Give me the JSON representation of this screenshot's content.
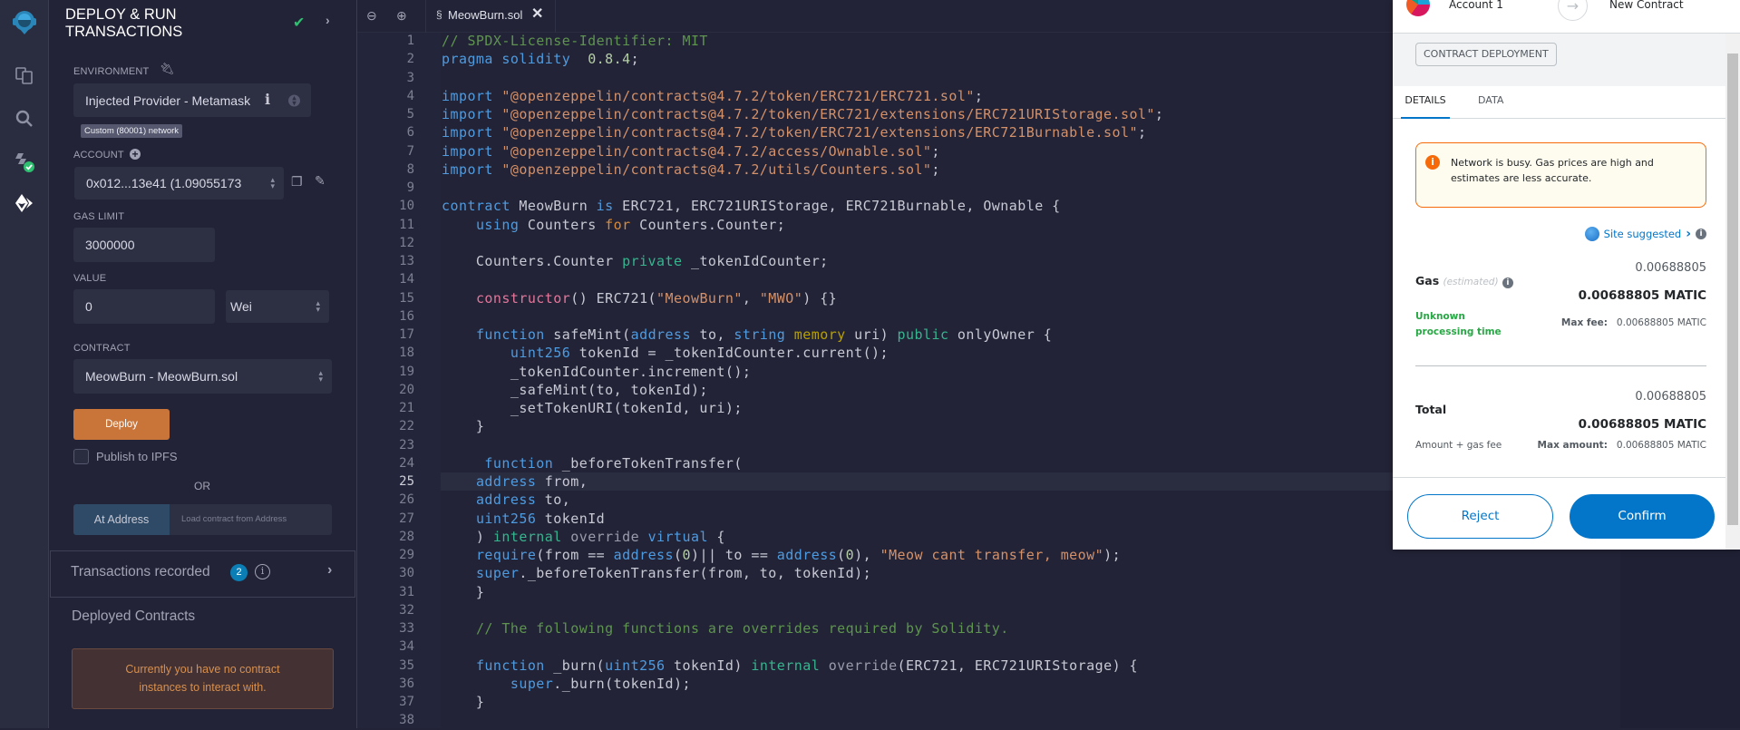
{
  "iconbar": {
    "items": [
      "remix-logo-icon",
      "file-explorer-icon",
      "search-icon",
      "solidity-compiler-icon",
      "deploy-run-icon"
    ]
  },
  "side": {
    "title_line1": "DEPLOY & RUN",
    "title_line2": "TRANSACTIONS",
    "environment_label": "ENVIRONMENT",
    "environment_value": "Injected Provider - Metamask",
    "network_badge": "Custom (80001) network",
    "account_label": "ACCOUNT",
    "account_value": "0x012...13e41 (1.09055173",
    "gas_limit_label": "GAS LIMIT",
    "gas_limit_value": "3000000",
    "value_label": "VALUE",
    "value_value": "0",
    "value_unit": "Wei",
    "contract_label": "CONTRACT",
    "contract_value": "MeowBurn - MeowBurn.sol",
    "deploy_button": "Deploy",
    "publish_ipfs": "Publish to IPFS",
    "publish_ipfs_checked": false,
    "or": "OR",
    "at_address_button": "At Address",
    "at_address_placeholder": "Load contract from Address",
    "transactions_recorded": "Transactions recorded",
    "transactions_count": "2",
    "deployed_contracts": "Deployed Contracts",
    "no_instances": "Currently you have no contract instances to interact with.",
    "colors": {
      "deploy": "#c97539",
      "at_address": "#2e4a66",
      "badge": "#0b7fb5",
      "success": "#2fbf71"
    }
  },
  "editor": {
    "tab_label": "MeowBurn.sol",
    "current_line": 25,
    "lines": [
      [
        [
          "t-c",
          "// SPDX-License-Identifier: MIT"
        ]
      ],
      [
        [
          "t-k",
          "pragma solidity"
        ],
        [
          "",
          "  "
        ],
        [
          "t-n",
          "0.8.4"
        ],
        [
          "",
          ";"
        ]
      ],
      [],
      [
        [
          "t-k",
          "import"
        ],
        [
          "",
          " "
        ],
        [
          "t-s",
          "\"@openzeppelin/contracts@4.7.2/token/ERC721/ERC721.sol\""
        ],
        [
          "",
          ";"
        ]
      ],
      [
        [
          "t-k",
          "import"
        ],
        [
          "",
          " "
        ],
        [
          "t-s",
          "\"@openzeppelin/contracts@4.7.2/token/ERC721/extensions/ERC721URIStorage.sol\""
        ],
        [
          "",
          ";"
        ]
      ],
      [
        [
          "t-k",
          "import"
        ],
        [
          "",
          " "
        ],
        [
          "t-s",
          "\"@openzeppelin/contracts@4.7.2/token/ERC721/extensions/ERC721Burnable.sol\""
        ],
        [
          "",
          ";"
        ]
      ],
      [
        [
          "t-k",
          "import"
        ],
        [
          "",
          " "
        ],
        [
          "t-s",
          "\"@openzeppelin/contracts@4.7.2/access/Ownable.sol\""
        ],
        [
          "",
          ";"
        ]
      ],
      [
        [
          "t-k",
          "import"
        ],
        [
          "",
          " "
        ],
        [
          "t-s",
          "\"@openzeppelin/contracts@4.7.2/utils/Counters.sol\""
        ],
        [
          "",
          ";"
        ]
      ],
      [],
      [
        [
          "t-k",
          "contract"
        ],
        [
          "",
          " MeowBurn "
        ],
        [
          "t-k",
          "is"
        ],
        [
          "",
          " ERC721, ERC721URIStorage, ERC721Burnable, Ownable {"
        ]
      ],
      [
        [
          "",
          "    "
        ],
        [
          "t-k",
          "using"
        ],
        [
          "",
          " Counters "
        ],
        [
          "t-o",
          "for"
        ],
        [
          "",
          " Counters.Counter;"
        ]
      ],
      [],
      [
        [
          "",
          "    Counters.Counter "
        ],
        [
          "t-m",
          "private"
        ],
        [
          "",
          " _tokenIdCounter;"
        ]
      ],
      [],
      [
        [
          "",
          "    "
        ],
        [
          "t-p",
          "constructor"
        ],
        [
          "",
          "() ERC721("
        ],
        [
          "t-s",
          "\"MeowBurn\""
        ],
        [
          "",
          ", "
        ],
        [
          "t-s",
          "\"MWO\""
        ],
        [
          "",
          ") {}"
        ]
      ],
      [],
      [
        [
          "",
          "    "
        ],
        [
          "t-k",
          "function"
        ],
        [
          "",
          " safeMint("
        ],
        [
          "t-k",
          "address"
        ],
        [
          "",
          " to, "
        ],
        [
          "t-k",
          "string"
        ],
        [
          "",
          " "
        ],
        [
          "t-y",
          "memory"
        ],
        [
          "",
          " uri) "
        ],
        [
          "t-m",
          "public"
        ],
        [
          "",
          " onlyOwner {"
        ]
      ],
      [
        [
          "",
          "        "
        ],
        [
          "t-k",
          "uint256"
        ],
        [
          "",
          " tokenId = _tokenIdCounter.current();"
        ]
      ],
      [
        [
          "",
          "        _tokenIdCounter.increment();"
        ]
      ],
      [
        [
          "",
          "        _safeMint(to, tokenId);"
        ]
      ],
      [
        [
          "",
          "        _setTokenURI(tokenId, uri);"
        ]
      ],
      [
        [
          "",
          "    }"
        ]
      ],
      [],
      [
        [
          "",
          "     "
        ],
        [
          "t-k",
          "function"
        ],
        [
          "",
          " _beforeTokenTransfer("
        ]
      ],
      [
        [
          "",
          "    "
        ],
        [
          "t-k",
          "address"
        ],
        [
          "",
          " from,"
        ]
      ],
      [
        [
          "",
          "    "
        ],
        [
          "t-k",
          "address"
        ],
        [
          "",
          " to,"
        ]
      ],
      [
        [
          "",
          "    "
        ],
        [
          "t-k",
          "uint256"
        ],
        [
          "",
          " tokenId"
        ]
      ],
      [
        [
          "",
          "    ) "
        ],
        [
          "t-m",
          "internal"
        ],
        [
          "",
          " "
        ],
        [
          "t-g",
          "override"
        ],
        [
          "",
          " "
        ],
        [
          "t-k",
          "virtual"
        ],
        [
          "",
          " {"
        ]
      ],
      [
        [
          "",
          "    "
        ],
        [
          "t-k",
          "require"
        ],
        [
          "",
          "(from == "
        ],
        [
          "t-k",
          "address"
        ],
        [
          "",
          "("
        ],
        [
          "t-n",
          "0"
        ],
        [
          "",
          ")|| to == "
        ],
        [
          "t-k",
          "address"
        ],
        [
          "",
          "("
        ],
        [
          "t-n",
          "0"
        ],
        [
          "",
          "), "
        ],
        [
          "t-s",
          "\"Meow cant transfer, meow\""
        ],
        [
          "",
          ");"
        ]
      ],
      [
        [
          "",
          "    "
        ],
        [
          "t-k",
          "super"
        ],
        [
          "",
          "._beforeTokenTransfer(from, to, tokenId);"
        ]
      ],
      [
        [
          "",
          "    }"
        ]
      ],
      [],
      [
        [
          "",
          "    "
        ],
        [
          "t-c",
          "// The following functions are overrides required by Solidity."
        ]
      ],
      [],
      [
        [
          "",
          "    "
        ],
        [
          "t-k",
          "function"
        ],
        [
          "",
          " _burn("
        ],
        [
          "t-k",
          "uint256"
        ],
        [
          "",
          " tokenId) "
        ],
        [
          "t-m",
          "internal"
        ],
        [
          "",
          " "
        ],
        [
          "t-g",
          "override"
        ],
        [
          "",
          "(ERC721, ERC721URIStorage) {"
        ]
      ],
      [
        [
          "",
          "        "
        ],
        [
          "t-k",
          "super"
        ],
        [
          "",
          "._burn(tokenId);"
        ]
      ],
      [
        [
          "",
          "    }"
        ]
      ],
      []
    ]
  },
  "metamask": {
    "from_account": "Account 1",
    "to": "New Contract",
    "badge": "CONTRACT DEPLOYMENT",
    "tabs": [
      "DETAILS",
      "DATA"
    ],
    "active_tab": "DETAILS",
    "warning": "Network is busy. Gas prices are high and estimates are less accurate.",
    "site_suggested": "Site suggested",
    "gas_label": "Gas",
    "gas_estimated": "(estimated)",
    "gas_value": "0.00688805",
    "gas_value_bold": "0.00688805 MATIC",
    "processing_time": "Unknown processing time",
    "max_fee_label": "Max fee:",
    "max_fee_value": "0.00688805 MATIC",
    "total_label": "Total",
    "total_value": "0.00688805",
    "total_value_bold": "0.00688805 MATIC",
    "amount_gas_fee": "Amount + gas fee",
    "max_amount_label": "Max amount:",
    "max_amount_value": "0.00688805 MATIC",
    "reject": "Reject",
    "confirm": "Confirm",
    "colors": {
      "primary": "#0376c9",
      "warning_border": "#f66a0a",
      "warning_bg": "#fefcee",
      "green": "#28a745"
    }
  }
}
